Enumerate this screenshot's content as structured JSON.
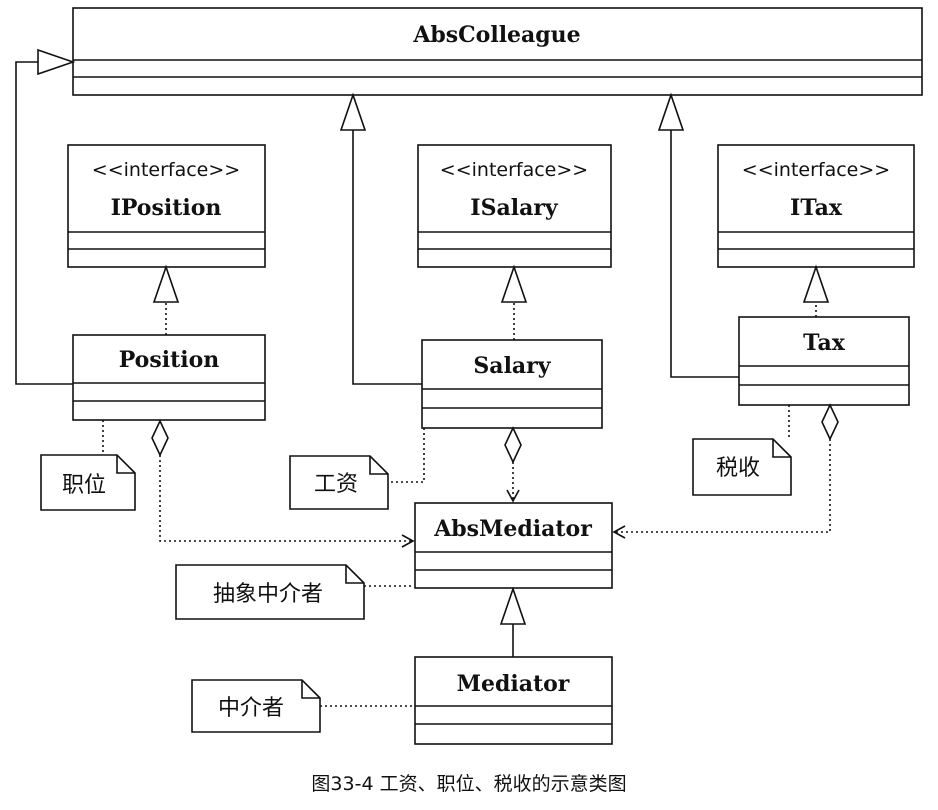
{
  "classes": {
    "abs_colleague": {
      "name": "AbsColleague"
    },
    "iposition": {
      "stereotype": "<<interface>>",
      "name": "IPosition"
    },
    "isalary": {
      "stereotype": "<<interface>>",
      "name": "ISalary"
    },
    "itax": {
      "stereotype": "<<interface>>",
      "name": "ITax"
    },
    "position": {
      "name": "Position"
    },
    "salary": {
      "name": "Salary"
    },
    "tax": {
      "name": "Tax"
    },
    "abs_mediator": {
      "name": "AbsMediator"
    },
    "mediator": {
      "name": "Mediator"
    }
  },
  "notes": {
    "position": "职位",
    "salary": "工资",
    "tax": "税收",
    "abs_mediator": "抽象中介者",
    "mediator": "中介者"
  },
  "caption": "图33-4 工资、职位、税收的示意类图"
}
